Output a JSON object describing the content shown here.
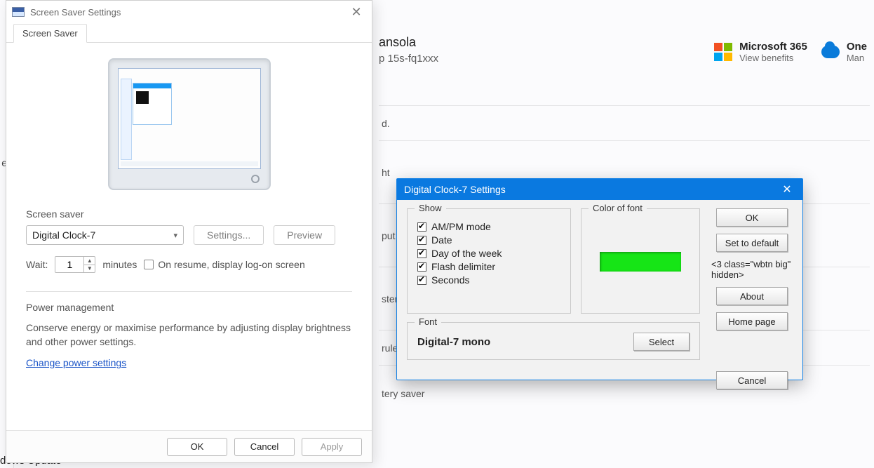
{
  "bg": {
    "user_name": "ansola",
    "user_sub": "p 15s-fq1xxx",
    "ms365_title": "Microsoft 365",
    "ms365_sub": "View benefits",
    "one_title": "One",
    "one_sub": "Man",
    "update_text": "dows Update",
    "row_d": "d.",
    "row_ht": "ht",
    "row_put": "put",
    "row_stem": "stem",
    "row_rules": " rules",
    "row_saver": "tery saver"
  },
  "dlg": {
    "title": "Screen Saver Settings",
    "tab": "Screen Saver",
    "ss_label": "Screen saver",
    "ss_value": "Digital Clock-7",
    "settings_btn": "Settings...",
    "preview_btn": "Preview",
    "wait_label": "Wait:",
    "wait_value": "1",
    "minutes_label": "minutes",
    "resume_label": "On resume, display log-on screen",
    "power_title": "Power management",
    "power_desc": "Conserve energy or maximise performance by adjusting display brightness and other power settings.",
    "power_link": "Change power settings",
    "ok": "OK",
    "cancel": "Cancel",
    "apply": "Apply"
  },
  "dc": {
    "title": "Digital Clock-7 Settings",
    "show_legend": "Show",
    "opt_ampm": "AM/PM mode",
    "opt_date": "Date",
    "opt_dow": "Day of the week",
    "opt_flash": "Flash delimiter",
    "opt_sec": "Seconds",
    "color_legend": "Color of font",
    "font_legend": "Font",
    "font_name": "Digital-7 mono",
    "select_btn": "Select",
    "ok": "OK",
    "set_default": "Set to default",
    "about": "About",
    "home": "Home page",
    "cancel": "Cancel",
    "color": "#16e516"
  }
}
